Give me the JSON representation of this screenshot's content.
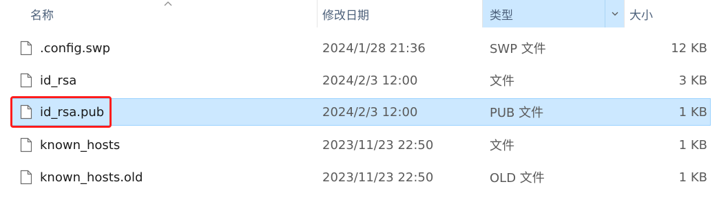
{
  "columns": {
    "name": "名称",
    "date_modified": "修改日期",
    "type": "类型",
    "size": "大小"
  },
  "sort": {
    "column": "name",
    "direction": "ascending",
    "icon": "sort-up-chevron-icon"
  },
  "files": [
    {
      "name": ".config.swp",
      "date": "2024/1/28 21:36",
      "type": "SWP 文件",
      "size": "12 KB",
      "icon": "file-icon"
    },
    {
      "name": "id_rsa",
      "date": "2024/2/3 12:00",
      "type": "文件",
      "size": "3 KB",
      "icon": "file-icon"
    },
    {
      "name": "id_rsa.pub",
      "date": "2024/2/3 12:00",
      "type": "PUB 文件",
      "size": "1 KB",
      "icon": "file-icon",
      "selected": true
    },
    {
      "name": "known_hosts",
      "date": "2023/11/23 22:50",
      "type": "文件",
      "size": "1 KB",
      "icon": "file-icon"
    },
    {
      "name": "known_hosts.old",
      "date": "2023/11/23 22:50",
      "type": "OLD 文件",
      "size": "1 KB",
      "icon": "file-icon"
    }
  ],
  "colors": {
    "selection_bg": "#cce8ff",
    "selection_border": "#99d1ff",
    "annotation_red": "#ff1c1c",
    "header_text": "#4c607a"
  }
}
